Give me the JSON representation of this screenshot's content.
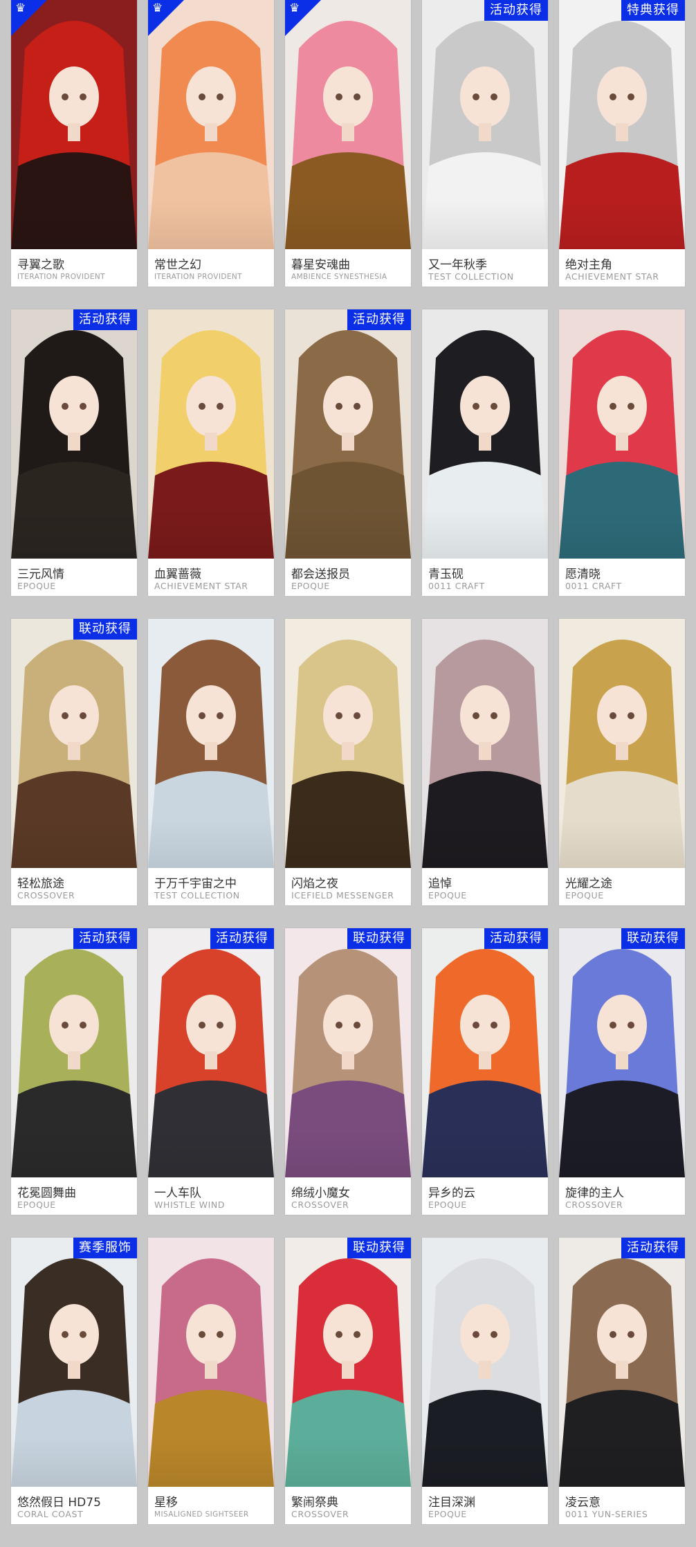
{
  "cards": [
    {
      "name": "寻翼之歌",
      "series": "ITERATION PROVIDENT",
      "badge": "",
      "corner": true,
      "hair": "#c61f18",
      "bg": "#8a1e1e",
      "cloth": "#2a1412"
    },
    {
      "name": "常世之幻",
      "series": "ITERATION PROVIDENT",
      "badge": "",
      "corner": true,
      "hair": "#f08a50",
      "bg": "#f3dccd",
      "cloth": "#f0c2a0"
    },
    {
      "name": "暮星安魂曲",
      "series": "AMBIENCE SYNESTHESIA",
      "badge": "",
      "corner": true,
      "hair": "#ee8aa0",
      "bg": "#efe9e6",
      "cloth": "#8a5a22"
    },
    {
      "name": "又一年秋季",
      "series": "TEST COLLECTION",
      "badge": "活动获得",
      "corner": false,
      "hair": "#c9c9c9",
      "bg": "#ececec",
      "cloth": "#f2f2f2"
    },
    {
      "name": "绝对主角",
      "series": "ACHIEVEMENT STAR",
      "badge": "特典获得",
      "corner": false,
      "hair": "#c8c8c8",
      "bg": "#f2f2f2",
      "cloth": "#b81e1e"
    },
    {
      "name": "三元风情",
      "series": "EPOQUE",
      "badge": "活动获得",
      "corner": false,
      "hair": "#1f1a17",
      "bg": "#ddd6cf",
      "cloth": "#2b2520"
    },
    {
      "name": "血翼蔷薇",
      "series": "ACHIEVEMENT STAR",
      "badge": "",
      "corner": false,
      "hair": "#f1cf6a",
      "bg": "#efe3d0",
      "cloth": "#7a1a1a"
    },
    {
      "name": "都会送报员",
      "series": "EPOQUE",
      "badge": "活动获得",
      "corner": false,
      "hair": "#8b6a48",
      "bg": "#eae2d6",
      "cloth": "#6e5433"
    },
    {
      "name": "青玉砚",
      "series": "0011 CRAFT",
      "badge": "",
      "corner": false,
      "hair": "#1d1d22",
      "bg": "#e9e9e9",
      "cloth": "#e8eef0"
    },
    {
      "name": "愿清晓",
      "series": "0011 CRAFT",
      "badge": "",
      "corner": false,
      "hair": "#e03a4a",
      "bg": "#eedcd8",
      "cloth": "#2d6a78"
    },
    {
      "name": "轻松旅途",
      "series": "CROSSOVER",
      "badge": "联动获得",
      "corner": false,
      "hair": "#c9b07a",
      "bg": "#ece7dd",
      "cloth": "#5a3a26"
    },
    {
      "name": "于万千宇宙之中",
      "series": "TEST COLLECTION",
      "badge": "",
      "corner": false,
      "hair": "#8a5a3a",
      "bg": "#e7ecf0",
      "cloth": "#c9d6e0"
    },
    {
      "name": "闪焰之夜",
      "series": "ICEFIELD MESSENGER",
      "badge": "",
      "corner": false,
      "hair": "#d9c58a",
      "bg": "#f2ece0",
      "cloth": "#3b2b1a"
    },
    {
      "name": "追悼",
      "series": "EPOQUE",
      "badge": "",
      "corner": false,
      "hair": "#b79a9e",
      "bg": "#e6e1e2",
      "cloth": "#1e1b20"
    },
    {
      "name": "光耀之途",
      "series": "EPOQUE",
      "badge": "",
      "corner": false,
      "hair": "#c8a24c",
      "bg": "#f1ebdf",
      "cloth": "#e6dccb"
    },
    {
      "name": "花冕圆舞曲",
      "series": "EPOQUE",
      "badge": "活动获得",
      "corner": false,
      "hair": "#a8b15a",
      "bg": "#ececec",
      "cloth": "#2b2a2a"
    },
    {
      "name": "一人车队",
      "series": "WHISTLE WIND",
      "badge": "活动获得",
      "corner": false,
      "hair": "#d8412a",
      "bg": "#f0eeee",
      "cloth": "#2f2f35"
    },
    {
      "name": "绵绒小魔女",
      "series": "CROSSOVER",
      "badge": "联动获得",
      "corner": false,
      "hair": "#b69278",
      "bg": "#f3e7ea",
      "cloth": "#7a4c7e"
    },
    {
      "name": "异乡的云",
      "series": "EPOQUE",
      "badge": "活动获得",
      "corner": false,
      "hair": "#ef6a2a",
      "bg": "#eceeed",
      "cloth": "#2a2f58"
    },
    {
      "name": "旋律的主人",
      "series": "CROSSOVER",
      "badge": "联动获得",
      "corner": false,
      "hair": "#6a7ad8",
      "bg": "#e9e9ee",
      "cloth": "#1c1c26"
    },
    {
      "name": "悠然假日 HD75",
      "series": "CORAL COAST",
      "badge": "赛季服饰",
      "corner": false,
      "hair": "#3a2d24",
      "bg": "#e9edf0",
      "cloth": "#c7d3de"
    },
    {
      "name": "星移",
      "series": "MISALIGNED SIGHTSEER",
      "badge": "",
      "corner": false,
      "hair": "#c86a8a",
      "bg": "#f2e3e6",
      "cloth": "#b9862a"
    },
    {
      "name": "繁闹祭典",
      "series": "CROSSOVER",
      "badge": "联动获得",
      "corner": false,
      "hair": "#d92e3a",
      "bg": "#f1ece8",
      "cloth": "#5cae9a"
    },
    {
      "name": "注目深渊",
      "series": "EPOQUE",
      "badge": "",
      "corner": false,
      "hair": "#dcdde0",
      "bg": "#e9ecef",
      "cloth": "#1b1d24"
    },
    {
      "name": "凌云意",
      "series": "0011 YUN-SERIES",
      "badge": "活动获得",
      "corner": false,
      "hair": "#8b6a52",
      "bg": "#eeeae6",
      "cloth": "#1f1f22"
    }
  ],
  "corner_glyph": "♛"
}
